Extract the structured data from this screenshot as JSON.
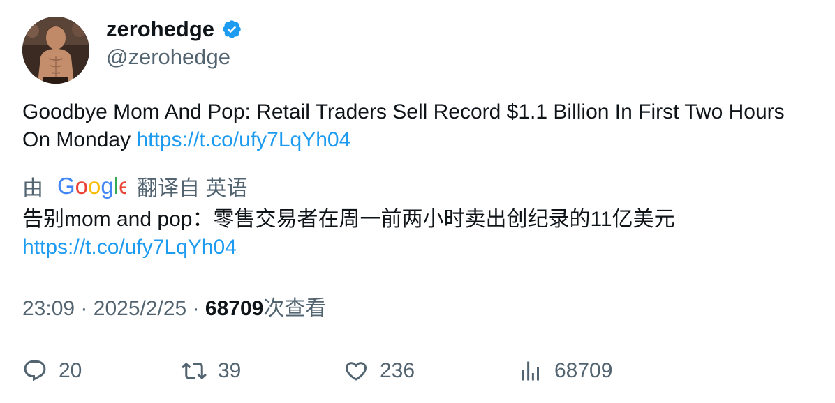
{
  "author": {
    "display_name": "zerohedge",
    "handle": "@zerohedge",
    "verified": true
  },
  "tweet": {
    "text": "Goodbye Mom And Pop: Retail Traders Sell Record $1.1 Billion In First Two Hours On Monday ",
    "link": "https://t.co/ufy7LqYh04"
  },
  "translation": {
    "prefix": "由",
    "provider": "Google",
    "suffix": "翻译自 英语",
    "text": "告别mom and pop：零售交易者在周一前两小时卖出创纪录的11亿美元",
    "link": "https://t.co/ufy7LqYh04"
  },
  "meta": {
    "time": "23:09",
    "date": "2025/2/25",
    "separator": "·",
    "views_count": "68709",
    "views_label": "次查看"
  },
  "actions": {
    "replies": "20",
    "retweets": "39",
    "likes": "236",
    "views": "68709"
  },
  "colors": {
    "link": "#1d9bf0",
    "secondary_text": "#536471",
    "primary_text": "#0f1419",
    "verified_badge": "#1d9bf0"
  },
  "icons": [
    "verified-badge-icon",
    "reply-icon",
    "retweet-icon",
    "like-icon",
    "views-icon",
    "google-logo"
  ]
}
